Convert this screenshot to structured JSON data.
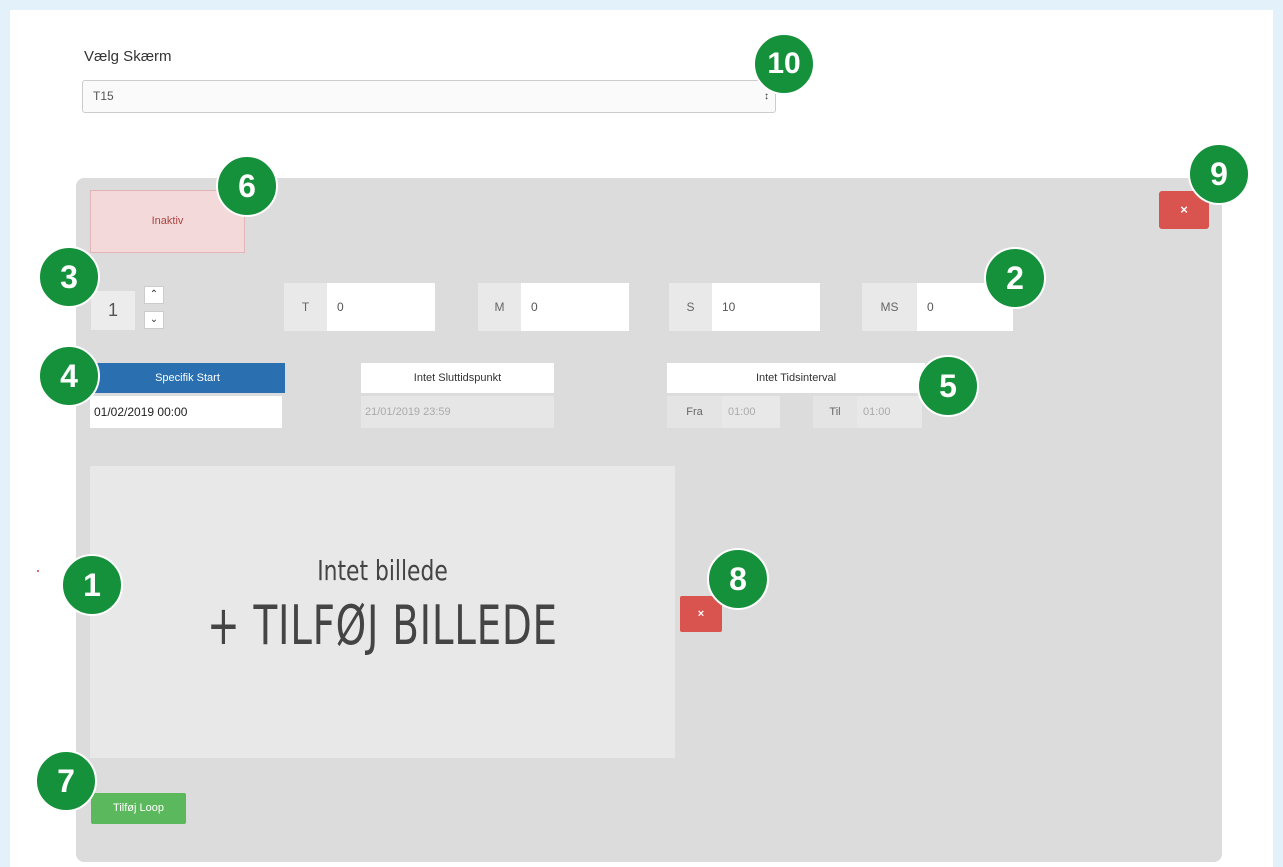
{
  "screen_select": {
    "label": "Vælg Skærm",
    "value": "T15",
    "arrow": "↕"
  },
  "panel": {
    "status": "Inaktiv",
    "close_label": "×",
    "order": {
      "value": "1",
      "up": "⌃",
      "down": "⌄"
    },
    "duration": [
      {
        "unit": "T",
        "value": "0"
      },
      {
        "unit": "M",
        "value": "0"
      },
      {
        "unit": "S",
        "value": "10"
      },
      {
        "unit": "MS",
        "value": "0"
      }
    ],
    "start": {
      "button": "Specifik Start",
      "value": "01/02/2019 00:00"
    },
    "end": {
      "button": "Intet Sluttidspunkt",
      "value": "21/01/2019 23:59"
    },
    "interval": {
      "button": "Intet Tidsinterval",
      "from_label": "Fra",
      "from_value": "01:00",
      "to_label": "Til",
      "to_value": "01:00"
    },
    "image": {
      "empty_text": "Intet billede",
      "add_text": "+ TILFØJ BILLEDE",
      "close_label": "×"
    },
    "add_loop": "Tilføj Loop"
  },
  "badges": [
    "1",
    "2",
    "3",
    "4",
    "5",
    "6",
    "7",
    "8",
    "9",
    "10"
  ],
  "colors": {
    "badge": "#15913b",
    "danger": "#d9534f",
    "primary": "#2a6fb0",
    "success": "#5cb85c"
  }
}
